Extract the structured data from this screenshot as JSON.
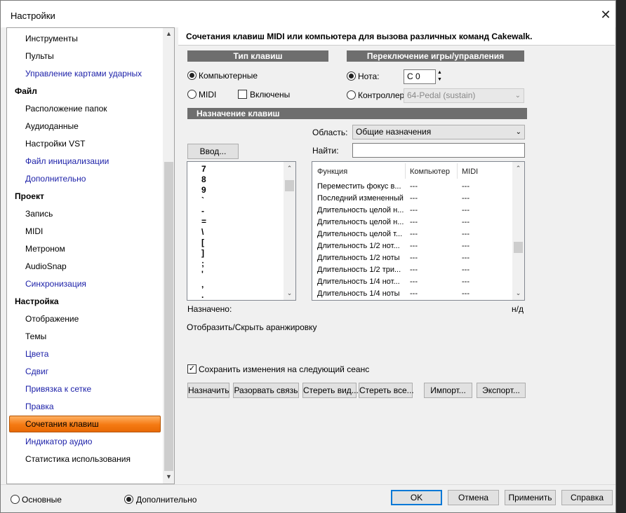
{
  "window": {
    "title": "Настройки"
  },
  "sidebar": {
    "items": [
      {
        "label": "Инструменты",
        "kind": "item"
      },
      {
        "label": "Пульты",
        "kind": "item"
      },
      {
        "label": "Управление картами ударных",
        "kind": "link"
      },
      {
        "label": "Файл",
        "kind": "category"
      },
      {
        "label": "Расположение папок",
        "kind": "item"
      },
      {
        "label": "Аудиоданные",
        "kind": "item"
      },
      {
        "label": "Настройки VST",
        "kind": "item"
      },
      {
        "label": "Файл инициализации",
        "kind": "link"
      },
      {
        "label": "Дополнительно",
        "kind": "link"
      },
      {
        "label": "Проект",
        "kind": "category"
      },
      {
        "label": "Запись",
        "kind": "item"
      },
      {
        "label": "MIDI",
        "kind": "item"
      },
      {
        "label": "Метроном",
        "kind": "item"
      },
      {
        "label": "AudioSnap",
        "kind": "item"
      },
      {
        "label": "Синхронизация",
        "kind": "link"
      },
      {
        "label": "Настройка",
        "kind": "category"
      },
      {
        "label": "Отображение",
        "kind": "item"
      },
      {
        "label": "Темы",
        "kind": "item"
      },
      {
        "label": "Цвета",
        "kind": "link"
      },
      {
        "label": "Сдвиг",
        "kind": "link"
      },
      {
        "label": "Привязка к сетке",
        "kind": "link"
      },
      {
        "label": "Правка",
        "kind": "link"
      },
      {
        "label": "Сочетания клавиш",
        "kind": "selected"
      },
      {
        "label": "Индикатор аудио",
        "kind": "link"
      },
      {
        "label": "Статистика использования",
        "kind": "item"
      }
    ]
  },
  "main": {
    "header": "Сочетания клавиш MIDI или компьютера для вызова различных команд Cakewalk.",
    "key_type": {
      "title": "Тип клавиш",
      "computer_label": "Компьютерные",
      "midi_label": "MIDI",
      "enabled_label": "Включены",
      "selected": "computer"
    },
    "switch": {
      "title": "Переключение игры/управления",
      "note_label": "Нота:",
      "note_value": "C 0",
      "controller_label": "Контроллер:",
      "controller_value": "64-Pedal (sustain)",
      "selected": "note"
    },
    "assign": {
      "title": "Назначение клавиш",
      "area_label": "Область:",
      "area_value": "Общие назначения",
      "find_label": "Найти:",
      "find_value": "",
      "input_button": "Ввод...",
      "keys": [
        "7",
        "8",
        "9",
        "`",
        "-",
        "=",
        "\\",
        "[",
        "]",
        ";",
        "'",
        ",",
        "."
      ],
      "columns": [
        "Функция",
        "Компьютер",
        "MIDI"
      ],
      "rows": [
        [
          "Переместить фокус в...",
          "---",
          "---"
        ],
        [
          "Последний измененный",
          "---",
          "---"
        ],
        [
          "Длительность целой н...",
          "---",
          "---"
        ],
        [
          "Длительность целой н...",
          "---",
          "---"
        ],
        [
          "Длительность целой т...",
          "---",
          "---"
        ],
        [
          "Длительность 1/2 нот...",
          "---",
          "---"
        ],
        [
          "Длительность 1/2 ноты",
          "---",
          "---"
        ],
        [
          "Длительность 1/2 три...",
          "---",
          "---"
        ],
        [
          "Длительность 1/4 нот...",
          "---",
          "---"
        ],
        [
          "Длительность 1/4 ноты",
          "---",
          "---"
        ]
      ],
      "assigned_label": "Назначено:",
      "assigned_value": "н/д",
      "description": "Отобразить/Скрыть аранжировку",
      "save_label": "Сохранить изменения на следующий сеанс",
      "save_checked": true
    },
    "buttons": {
      "assign": "Назначить",
      "unbind": "Разорвать связь",
      "clear_view": "Стереть вид...",
      "clear_all": "Стереть все...",
      "import": "Импорт...",
      "export": "Экспорт..."
    }
  },
  "footer": {
    "basic_label": "Основные",
    "advanced_label": "Дополнительно",
    "mode": "advanced",
    "ok": "OK",
    "cancel": "Отмена",
    "apply": "Применить",
    "help": "Справка"
  },
  "colors": {
    "selection": "#f57a12",
    "link": "#1b1fa8",
    "group_header": "#6e6e6e",
    "focus": "#0078d7"
  }
}
